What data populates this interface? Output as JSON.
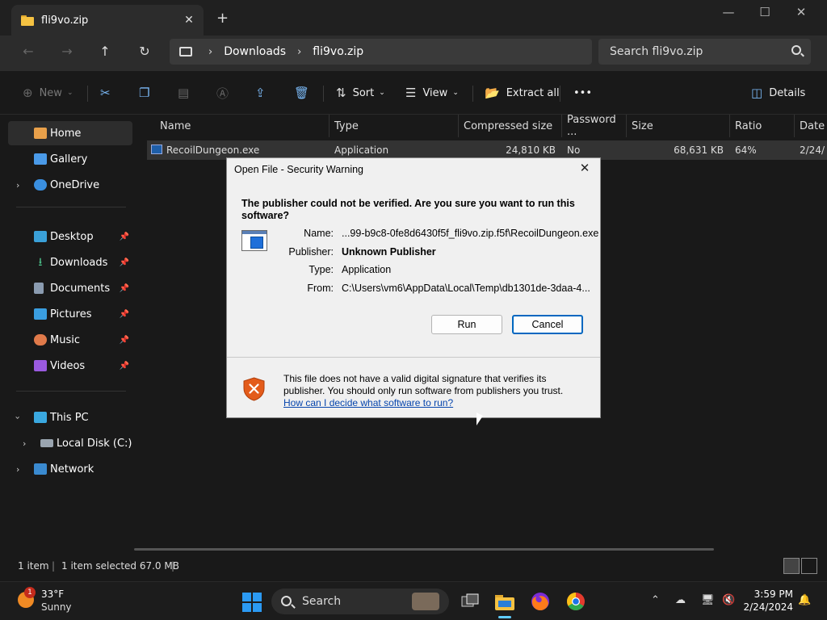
{
  "tab": {
    "title": "fli9vo.zip",
    "close": "✕",
    "new_tab": "+"
  },
  "window_controls": {
    "minimize": "—",
    "maximize": "☐",
    "close": "✕"
  },
  "nav": {
    "back": "←",
    "forward": "→",
    "up": "↑",
    "refresh": "↻"
  },
  "address": {
    "crumbs": [
      "Downloads",
      "fli9vo.zip"
    ],
    "separator": "›"
  },
  "search": {
    "placeholder": "Search fli9vo.zip"
  },
  "commands": {
    "new": "New",
    "sort": "Sort",
    "view": "View",
    "extract_all": "Extract all",
    "more": "•••",
    "details": "Details"
  },
  "sidebar": {
    "items": [
      {
        "label": "Home"
      },
      {
        "label": "Gallery"
      },
      {
        "label": "OneDrive"
      },
      {
        "label": "Desktop"
      },
      {
        "label": "Downloads"
      },
      {
        "label": "Documents"
      },
      {
        "label": "Pictures"
      },
      {
        "label": "Music"
      },
      {
        "label": "Videos"
      },
      {
        "label": "This PC"
      },
      {
        "label": "Local Disk (C:)"
      },
      {
        "label": "Network"
      }
    ]
  },
  "columns": [
    "Name",
    "Type",
    "Compressed size",
    "Password ...",
    "Size",
    "Ratio",
    "Date"
  ],
  "file": {
    "name": "RecoilDungeon.exe",
    "type": "Application",
    "compressed": "24,810 KB",
    "password": "No",
    "size": "68,631 KB",
    "ratio": "64%",
    "date": "2/24/"
  },
  "status": {
    "count": "1 item",
    "selected": "1 item selected  67.0 MB"
  },
  "dialog": {
    "title": "Open File - Security Warning",
    "close": "✕",
    "warning": "The publisher could not be verified.  Are you sure you want to run this software?",
    "name_label": "Name:",
    "name_value": "...99-b9c8-0fe8d6430f5f_fli9vo.zip.f5f\\RecoilDungeon.exe",
    "publisher_label": "Publisher:",
    "publisher_value": "Unknown Publisher",
    "type_label": "Type:",
    "type_value": "Application",
    "from_label": "From:",
    "from_value": "C:\\Users\\vm6\\AppData\\Local\\Temp\\db1301de-3daa-4...",
    "run": "Run",
    "cancel": "Cancel",
    "info": "This file does not have a valid digital signature that verifies its publisher.  You should only run software from publishers you trust.",
    "link": "How can I decide what software to run?"
  },
  "taskbar": {
    "weather_badge": "1",
    "temp": "33°F",
    "condition": "Sunny",
    "search": "Search",
    "time": "3:59 PM",
    "date": "2/24/2024"
  }
}
